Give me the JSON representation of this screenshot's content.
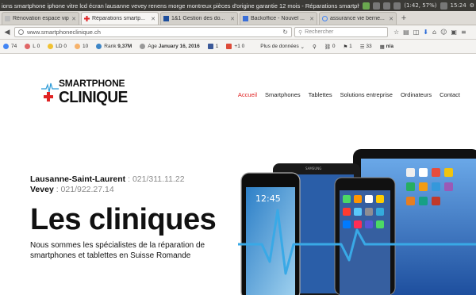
{
  "window": {
    "title": "ions smartphone iphone vitre lcd écran lausanne vevey renens morge montreux pièces d'origine garantie 12 mois - Réparations smartphone",
    "tray": {
      "battery": "(1:42, 57%)",
      "clock": "15:24"
    }
  },
  "tabs": [
    {
      "label": "Rénovation espace vip ..."
    },
    {
      "label": "Réparations smartp..."
    },
    {
      "label": "1&1 Gestion des do..."
    },
    {
      "label": "Backoffice - Nouvel ..."
    },
    {
      "label": "assurance vie berne..."
    }
  ],
  "navbar": {
    "url": "www.smartphoneclinique.ch",
    "search_placeholder": "Rechercher"
  },
  "seobar": {
    "items": [
      {
        "icon": "google-icon",
        "value": "74",
        "color": "#4285f4"
      },
      {
        "icon": "l-icon",
        "value": "0",
        "prefix": "L",
        "color": "#e06666"
      },
      {
        "icon": "ld-icon",
        "value": "0",
        "prefix": "LD",
        "color": "#f1c232"
      },
      {
        "icon": "b-icon",
        "value": "10",
        "prefix": "",
        "color": "#f6b26b"
      },
      {
        "icon": "rank-icon",
        "value": "9,37M",
        "prefix": "Rank",
        "color": "#3d85c6"
      },
      {
        "icon": "age-icon",
        "value": "January 16, 2016",
        "prefix": "Age",
        "color": "#999999"
      },
      {
        "icon": "facebook-icon",
        "value": "1",
        "prefix": "",
        "color": "#3b5998"
      },
      {
        "icon": "gplus-icon",
        "value": "0",
        "prefix": "+1",
        "color": "#dd4b39"
      }
    ],
    "dropdown": "Plus de données",
    "right_items": [
      {
        "icon": "pin-icon",
        "value": "",
        "color": "#888888"
      },
      {
        "icon": "link-icon",
        "value": "0",
        "color": "#888888"
      },
      {
        "icon": "flag-icon",
        "value": "1",
        "color": "#888888"
      },
      {
        "icon": "list-icon",
        "value": "33",
        "color": "#888888"
      },
      {
        "icon": "stat-icon",
        "value": "n/a",
        "color": "#888888"
      }
    ]
  },
  "site": {
    "logo_line1": "SMARTPHONE",
    "logo_line2": "CLINIQUE",
    "menu": [
      "Accueil",
      "Smartphones",
      "Tablettes",
      "Solutions entreprise",
      "Ordinateurs",
      "Contact"
    ],
    "contacts": [
      {
        "city": "Lausanne-Saint-Laurent",
        "phone": " : 021/311.11.22"
      },
      {
        "city": "Vevey",
        "phone": " : 021/922.27.14"
      }
    ],
    "hero_title": "Les cliniques",
    "description": "Nous sommes les spécialistes de la réparation de smartphones et tablettes en Suisse Romande",
    "phone_screen_time": "12:45",
    "accent_color": "#e02424"
  }
}
